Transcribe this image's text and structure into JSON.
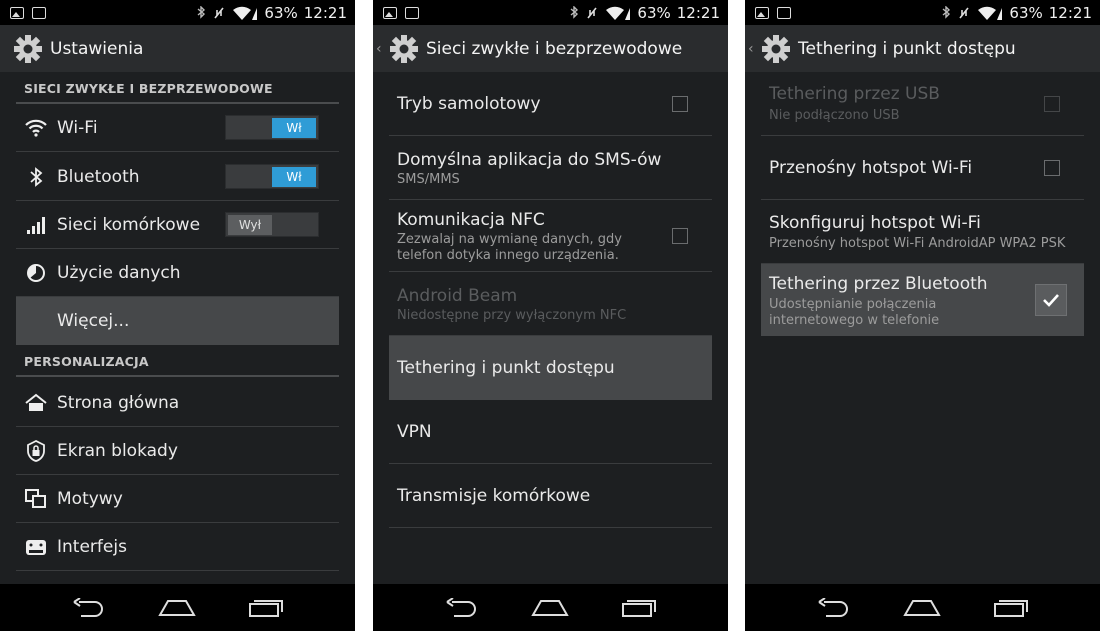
{
  "status": {
    "battery": "63%",
    "time": "12:21"
  },
  "screens": [
    {
      "title": "Ustawienia",
      "sections": [
        {
          "header": "SIECI ZWYKŁE I BEZPRZEWODOWE"
        },
        {
          "header": "PERSONALIZACJA"
        }
      ],
      "items": [
        {
          "label": "Wi-Fi",
          "toggle": "Wł"
        },
        {
          "label": "Bluetooth",
          "toggle": "Wł"
        },
        {
          "label": "Sieci komórkowe",
          "toggle": "Wył"
        },
        {
          "label": "Użycie danych"
        },
        {
          "label": "Więcej..."
        },
        {
          "label": "Strona główna"
        },
        {
          "label": "Ekran blokady"
        },
        {
          "label": "Motywy"
        },
        {
          "label": "Interfejs"
        }
      ]
    },
    {
      "title": "Sieci zwykłe i bezprzewodowe",
      "items": [
        {
          "title": "Tryb samolotowy"
        },
        {
          "title": "Domyślna aplikacja do SMS-ów",
          "sub": "SMS/MMS"
        },
        {
          "title": "Komunikacja NFC",
          "sub1": "Zezwalaj na wymianę danych, gdy",
          "sub2": "telefon dotyka innego urządzenia."
        },
        {
          "title": "Android Beam",
          "sub": "Niedostępne przy wyłączonym NFC"
        },
        {
          "title": "Tethering i punkt dostępu"
        },
        {
          "title": "VPN"
        },
        {
          "title": "Transmisje komórkowe"
        }
      ]
    },
    {
      "title": "Tethering i punkt dostępu",
      "items": [
        {
          "title": "Tethering przez USB",
          "sub": "Nie podłączono USB"
        },
        {
          "title": "Przenośny hotspot Wi-Fi"
        },
        {
          "title": "Skonfiguruj hotspot Wi-Fi",
          "sub": "Przenośny hotspot Wi-Fi AndroidAP WPA2 PSK"
        },
        {
          "title": "Tethering przez Bluetooth",
          "sub1": "Udostępnianie połączenia",
          "sub2": "internetowego w telefonie"
        }
      ]
    }
  ],
  "icons": {
    "gear": "gear-icon",
    "back": "back-caret-icon",
    "wifi": "wifi-icon",
    "bluetooth": "bluetooth-icon",
    "signal": "signal-icon",
    "data_usage": "data-usage-icon",
    "home": "home-icon",
    "lock": "lock-icon",
    "themes": "themes-icon",
    "interface": "interface-icon",
    "nav_back": "nav-back-icon",
    "nav_home": "nav-home-icon",
    "nav_recents": "nav-recents-icon"
  },
  "colors": {
    "accent": "#2f9cd6",
    "background": "#1d1f21",
    "actionbar": "#2a2c2e",
    "selected": "#46484a"
  }
}
